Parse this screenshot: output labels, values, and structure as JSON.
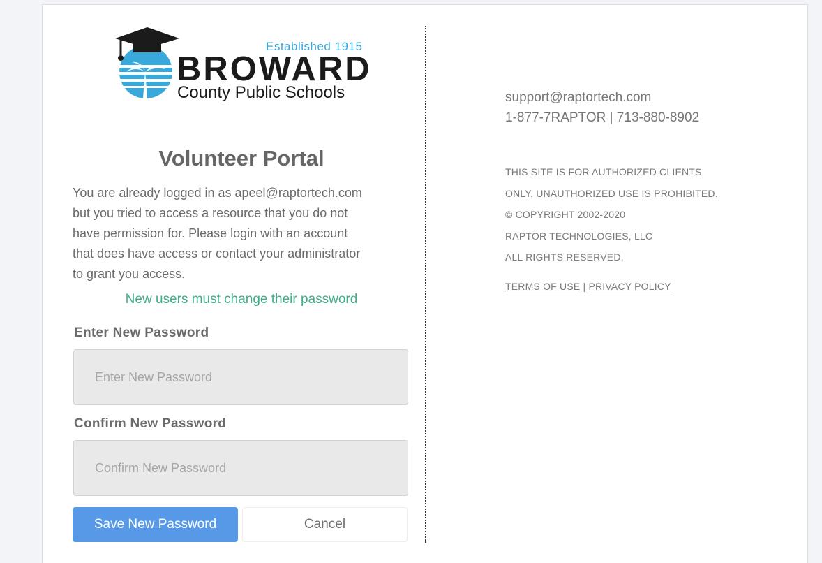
{
  "logo": {
    "established": "Established 1915",
    "brand": "BROWARD",
    "subtitle": "County Public Schools"
  },
  "portal": {
    "title": "Volunteer Portal",
    "message_lines": [
      "You are already logged in as apeel@raptortech.com",
      "but you tried to access a resource that you do not",
      "have permission for. Please login with an account",
      "that does have access or contact your administrator",
      "to grant you access."
    ],
    "notice": "New users must change their password"
  },
  "form": {
    "new_password": {
      "label": "Enter New Password",
      "placeholder": "Enter New Password",
      "value": ""
    },
    "confirm_password": {
      "label": "Confirm New Password",
      "placeholder": "Confirm New Password",
      "value": ""
    },
    "save_label": "Save New Password",
    "cancel_label": "Cancel"
  },
  "support": {
    "email": "support@raptortech.com",
    "phone": "1-877-7RAPTOR | 713-880-8902"
  },
  "legal": {
    "lines": [
      "THIS SITE IS FOR AUTHORIZED CLIENTS",
      "ONLY. UNAUTHORIZED USE IS PROHIBITED.",
      "© COPYRIGHT 2002-2020",
      "RAPTOR TECHNOLOGIES, LLC",
      "ALL RIGHTS RESERVED."
    ],
    "terms_label": "TERMS OF USE",
    "separator": " | ",
    "privacy_label": "PRIVACY POLICY"
  },
  "colors": {
    "primary_button": "#5799e6",
    "notice_text": "#3fae86",
    "logo_accent": "#3aa7da"
  }
}
